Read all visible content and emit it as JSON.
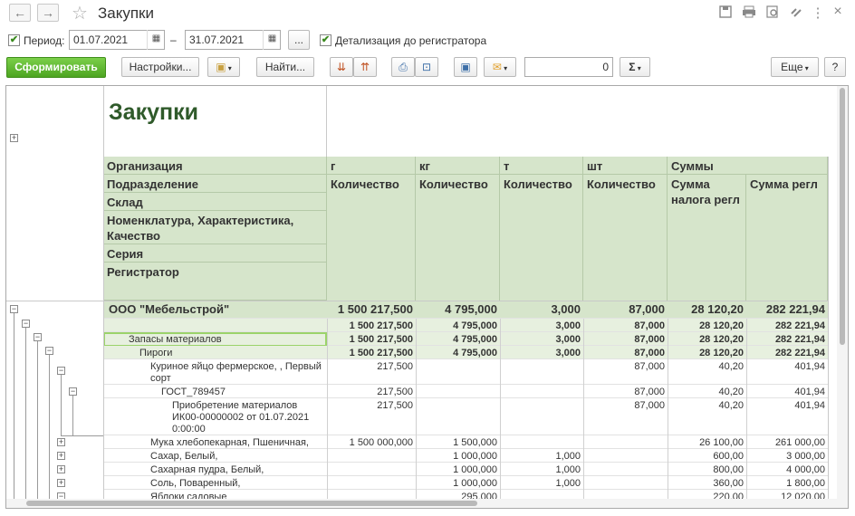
{
  "window": {
    "title": "Закупки",
    "nav_back": "←",
    "nav_forward": "→",
    "star": "☆",
    "icons": [
      "save-icon",
      "print-icon",
      "preview-icon",
      "link-icon",
      "more-vert-icon",
      "close-icon"
    ]
  },
  "params": {
    "period_label": "Период:",
    "period_checked": true,
    "date_from": "01.07.2021",
    "dash": "–",
    "date_to": "31.07.2021",
    "ellipsis": "...",
    "detail_label": "Детализация до регистратора",
    "detail_checked": true
  },
  "toolbar": {
    "generate": "Сформировать",
    "settings": "Настройки...",
    "find": "Найти...",
    "sum_value": "0",
    "sigma": "Σ",
    "more": "Еще",
    "help": "?"
  },
  "report": {
    "title": "Закупки",
    "group_headers": [
      "Организация",
      "Подразделение",
      "Склад",
      "Номенклатура, Характеристика, Качество",
      "Серия",
      "Регистратор"
    ],
    "unit_headers": [
      "г",
      "кг",
      "т",
      "шт",
      "Суммы"
    ],
    "sub_headers": [
      "Количество",
      "Количество",
      "Количество",
      "Количество",
      "Сумма налога регл",
      "Сумма регл"
    ],
    "rows": [
      {
        "name": "ООО \"Мебельстрой\"",
        "v": [
          "1 500 217,500",
          "4 795,000",
          "3,000",
          "87,000",
          "28 120,20",
          "282 221,94"
        ]
      },
      {
        "name": "",
        "v": [
          "1 500 217,500",
          "4 795,000",
          "3,000",
          "87,000",
          "28 120,20",
          "282 221,94"
        ]
      },
      {
        "name": "Запасы материалов",
        "v": [
          "1 500 217,500",
          "4 795,000",
          "3,000",
          "87,000",
          "28 120,20",
          "282 221,94"
        ]
      },
      {
        "name": "Пироги",
        "v": [
          "1 500 217,500",
          "4 795,000",
          "3,000",
          "87,000",
          "28 120,20",
          "282 221,94"
        ]
      },
      {
        "name": "Куриное яйцо фермерское, , Первый сорт",
        "v": [
          "217,500",
          "",
          "",
          "87,000",
          "40,20",
          "401,94"
        ]
      },
      {
        "name": "ГОСТ_789457",
        "v": [
          "217,500",
          "",
          "",
          "87,000",
          "40,20",
          "401,94"
        ]
      },
      {
        "name": "Приобретение материалов ИК00-00000002 от 01.07.2021 0:00:00",
        "v": [
          "217,500",
          "",
          "",
          "87,000",
          "40,20",
          "401,94"
        ]
      },
      {
        "name": "Мука хлебопекарная, Пшеничная,",
        "v": [
          "1 500 000,000",
          "1 500,000",
          "",
          "",
          "26 100,00",
          "261 000,00"
        ]
      },
      {
        "name": "Сахар, Белый,",
        "v": [
          "",
          "1 000,000",
          "1,000",
          "",
          "600,00",
          "3 000,00"
        ]
      },
      {
        "name": "Сахарная пудра, Белый,",
        "v": [
          "",
          "1 000,000",
          "1,000",
          "",
          "800,00",
          "4 000,00"
        ]
      },
      {
        "name": "Соль, Поваренный,",
        "v": [
          "",
          "1 000,000",
          "1,000",
          "",
          "360,00",
          "1 800,00"
        ]
      },
      {
        "name": "Яблоки садовые",
        "v": [
          "",
          "295,000",
          "",
          "",
          "220,00",
          "12 020,00"
        ]
      }
    ]
  }
}
